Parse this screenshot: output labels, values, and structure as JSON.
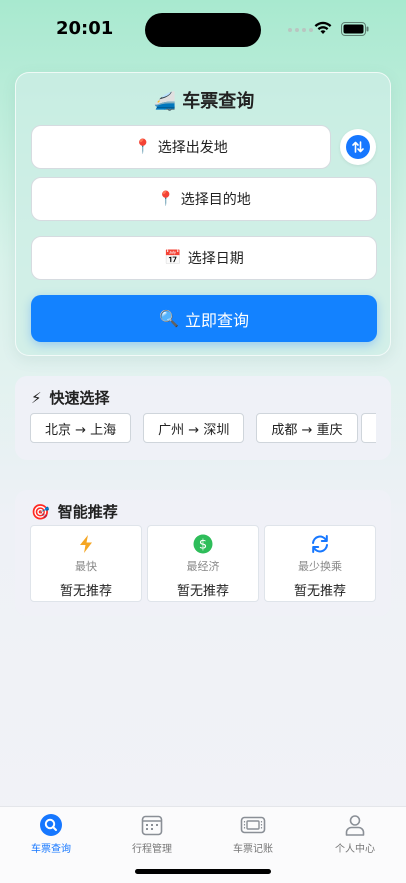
{
  "status_bar": {
    "time": "20:01"
  },
  "search": {
    "title": "车票查询",
    "title_emoji": "🚄",
    "from_placeholder": "选择出发地",
    "to_placeholder": "选择目的地",
    "date_placeholder": "选择日期",
    "query_label": "立即查询",
    "pin_emoji": "📍",
    "calendar_emoji": "📅",
    "magnifier_emoji": "🔍"
  },
  "quick": {
    "title": "快速选择",
    "icon_emoji": "⚡",
    "routes": [
      "北京 → 上海",
      "广州 → 深圳",
      "成都 → 重庆"
    ]
  },
  "recommend": {
    "title": "智能推荐",
    "icon_emoji": "🎯",
    "items": [
      {
        "label": "最快",
        "value": "暂无推荐",
        "icon": "lightning-icon"
      },
      {
        "label": "最经济",
        "value": "暂无推荐",
        "icon": "dollar-icon"
      },
      {
        "label": "最少换乘",
        "value": "暂无推荐",
        "icon": "refresh-icon"
      }
    ]
  },
  "tabs": [
    {
      "label": "车票查询",
      "icon": "search-icon",
      "active": true
    },
    {
      "label": "行程管理",
      "icon": "calendar-icon",
      "active": false
    },
    {
      "label": "车票记账",
      "icon": "ticket-icon",
      "active": false
    },
    {
      "label": "个人中心",
      "icon": "person-icon",
      "active": false
    }
  ],
  "colors": {
    "accent": "#1677ff",
    "button": "#1382ff",
    "lightning": "#f5a623",
    "dollar": "#2ebd5a"
  }
}
